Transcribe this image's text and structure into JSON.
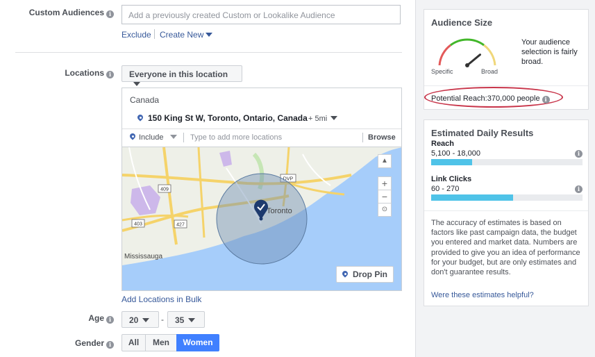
{
  "custom_audiences": {
    "label": "Custom Audiences",
    "placeholder": "Add a previously created Custom or Lookalike Audience",
    "exclude": "Exclude",
    "create_new": "Create New"
  },
  "locations": {
    "label": "Locations",
    "dropdown": "Everyone in this location",
    "country": "Canada",
    "address": "150 King St W, Toronto, Ontario, Canada",
    "radius": "+ 5mi",
    "include": "Include",
    "input_placeholder": "Type to add more locations",
    "browse": "Browse",
    "add_bulk": "Add Locations in Bulk"
  },
  "map": {
    "labels": [
      "Toronto",
      "Mississauga"
    ],
    "highway_shields": [
      "409",
      "403",
      "427",
      "DVP"
    ],
    "zoom_in": "+",
    "zoom_out": "−",
    "drop_pin": "Drop Pin",
    "water_color": "#a6cdfa",
    "circle_color": "#6f8fb3"
  },
  "age": {
    "label": "Age",
    "min": "20",
    "separator": "-",
    "max": "35"
  },
  "gender": {
    "label": "Gender",
    "options": [
      "All",
      "Men",
      "Women"
    ],
    "selected": "Women"
  },
  "audience_size": {
    "title": "Audience Size",
    "specific": "Specific",
    "broad": "Broad",
    "description": "Your audience selection is fairly broad.",
    "gauge_level": 0.78,
    "potential_reach_label": "Potential Reach:",
    "potential_reach_value": "370,000 people",
    "highlight_color": "#c8354a"
  },
  "daily_results": {
    "title": "Estimated Daily Results",
    "reach_label": "Reach",
    "reach_range": "5,100 - 18,000",
    "reach_fill": 0.27,
    "clicks_label": "Link Clicks",
    "clicks_range": "60 - 270",
    "clicks_fill": 0.54,
    "disclaimer": "The accuracy of estimates is based on factors like past campaign data, the budget you entered and market data. Numbers are provided to give you an idea of performance for your budget, but are only estimates and don't guarantee results.",
    "helpful_link": "Were these estimates helpful?",
    "bar_color": "#4fc3e8"
  }
}
